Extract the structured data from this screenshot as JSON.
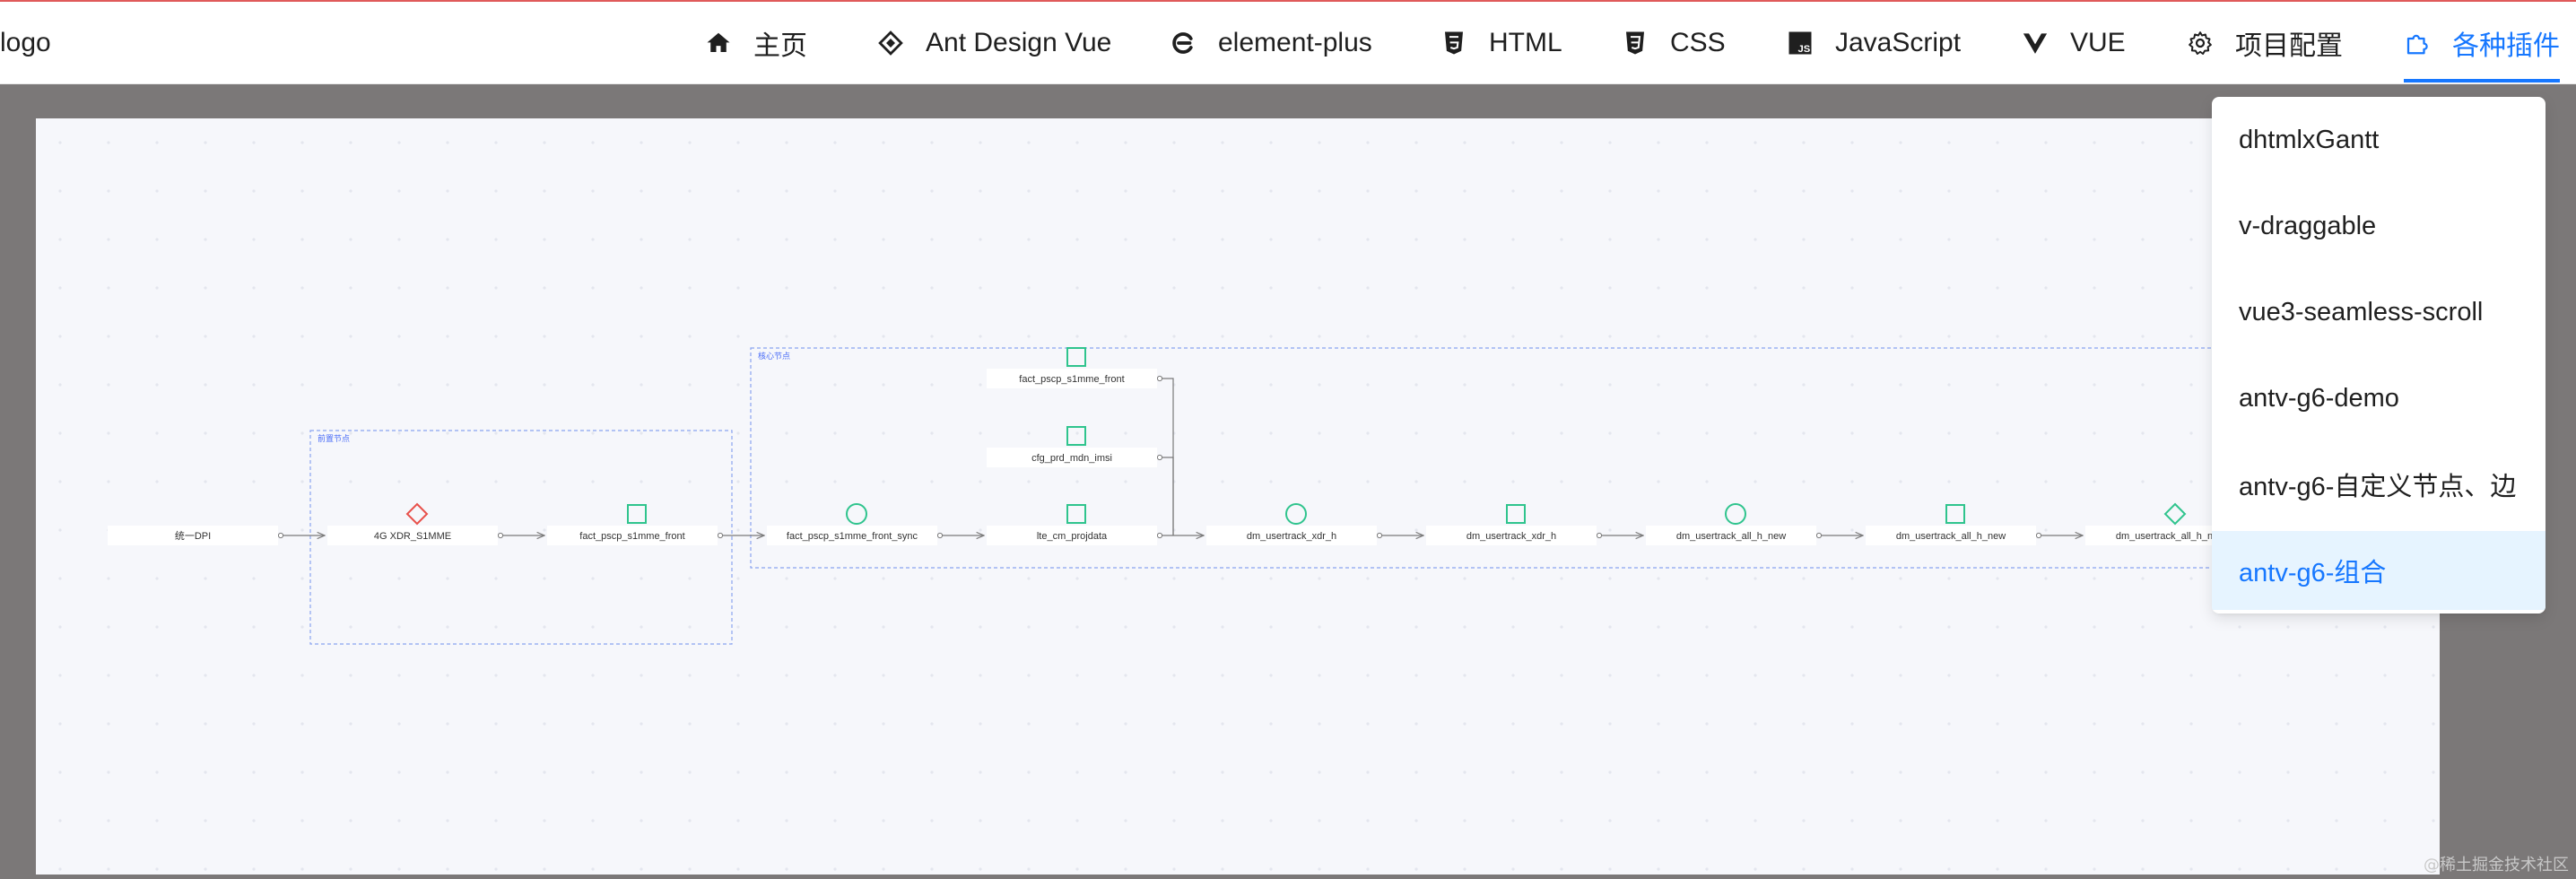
{
  "header": {
    "logo": "logo",
    "nav": [
      {
        "label": "主页",
        "icon": "home-icon"
      },
      {
        "label": "Ant Design Vue",
        "icon": "antd-icon"
      },
      {
        "label": "element-plus",
        "icon": "element-plus-icon"
      },
      {
        "label": "HTML",
        "icon": "html5-icon"
      },
      {
        "label": "CSS",
        "icon": "css3-icon"
      },
      {
        "label": "JavaScript",
        "icon": "javascript-icon"
      },
      {
        "label": "VUE",
        "icon": "vue-icon"
      },
      {
        "label": "项目配置",
        "icon": "gear-icon"
      },
      {
        "label": "各种插件",
        "icon": "puzzle-icon",
        "active": true
      }
    ]
  },
  "dropdown": {
    "items": [
      {
        "label": "dhtmlxGantt"
      },
      {
        "label": "v-draggable"
      },
      {
        "label": "vue3-seamless-scroll"
      },
      {
        "label": "antv-g6-demo"
      },
      {
        "label": "antv-g6-自定义节点、边"
      },
      {
        "label": "antv-g6-组合",
        "selected": true
      }
    ]
  },
  "graph": {
    "combos": [
      {
        "label": "前置节点"
      },
      {
        "label": "核心节点"
      }
    ],
    "nodes": [
      {
        "label": "统一DPI",
        "shape": "none"
      },
      {
        "label": "4G XDR_S1MME",
        "shape": "diamond",
        "color": "#e8504a"
      },
      {
        "label": "fact_pscp_s1mme_front",
        "shape": "square",
        "color": "#2fc48d"
      },
      {
        "label": "fact_pscp_s1mme_front_sync",
        "shape": "circle",
        "color": "#2fc48d"
      },
      {
        "label": "lte_cm_projdata",
        "shape": "square",
        "color": "#2fc48d"
      },
      {
        "label": "fact_pscp_s1mme_front",
        "shape": "square",
        "color": "#2fc48d"
      },
      {
        "label": "cfg_prd_mdn_imsi",
        "shape": "square",
        "color": "#2fc48d"
      },
      {
        "label": "dm_usertrack_xdr_h",
        "shape": "circle",
        "color": "#2fc48d"
      },
      {
        "label": "dm_usertrack_xdr_h",
        "shape": "square",
        "color": "#2fc48d"
      },
      {
        "label": "dm_usertrack_all_h_new",
        "shape": "circle",
        "color": "#2fc48d"
      },
      {
        "label": "dm_usertrack_all_h_new",
        "shape": "square",
        "color": "#2fc48d"
      },
      {
        "label": "dm_usertrack_all_h_new",
        "shape": "diamond",
        "color": "#2fc48d"
      }
    ]
  },
  "watermark": "@稀土掘金技术社区"
}
